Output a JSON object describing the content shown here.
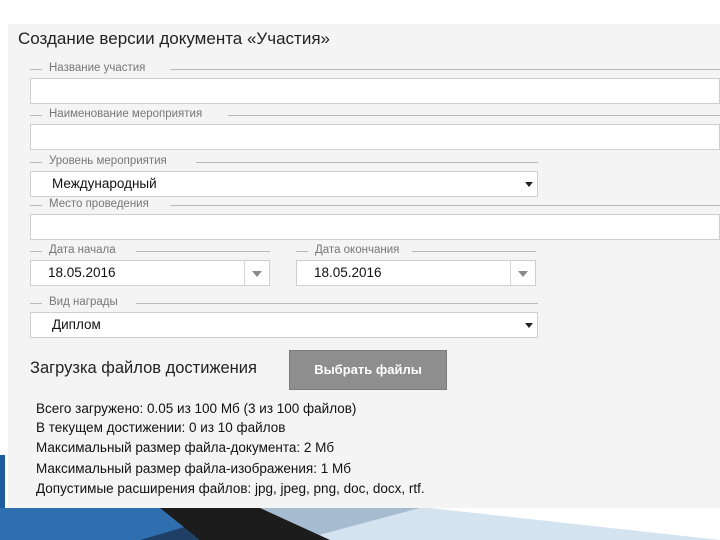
{
  "title": "Создание версии документа «Участия»",
  "fields": {
    "participation_name": {
      "legend": "Название участия",
      "value": ""
    },
    "event_name": {
      "legend": "Наименование мероприятия",
      "value": ""
    },
    "event_level": {
      "legend": "Уровень мероприятия",
      "value": "Международный"
    },
    "venue": {
      "legend": "Место проведения",
      "value": ""
    },
    "start_date": {
      "legend": "Дата начала",
      "value": "18.05.2016"
    },
    "end_date": {
      "legend": "Дата окончания",
      "value": "18.05.2016"
    },
    "award_type": {
      "legend": "Вид награды",
      "value": "Диплом"
    }
  },
  "upload": {
    "label": "Загрузка файлов достижения",
    "button_label": "Выбрать файлы"
  },
  "info_lines": [
    "Всего загружено: 0.05 из 100 Мб (3 из 100 файлов)",
    "В текущем достижении: 0 из 10 файлов",
    "Максимальный размер файла-документа: 2 Мб",
    "Максимальный размер файла-изображения: 1 Мб",
    "Допустимые расширения файлов: jpg, jpeg, png, doc, docx, rtf."
  ],
  "colors": {
    "panel_bg": "#f4f4f4",
    "button_bg": "#8e8e8e",
    "accent_deco": "#1b5e9e"
  }
}
